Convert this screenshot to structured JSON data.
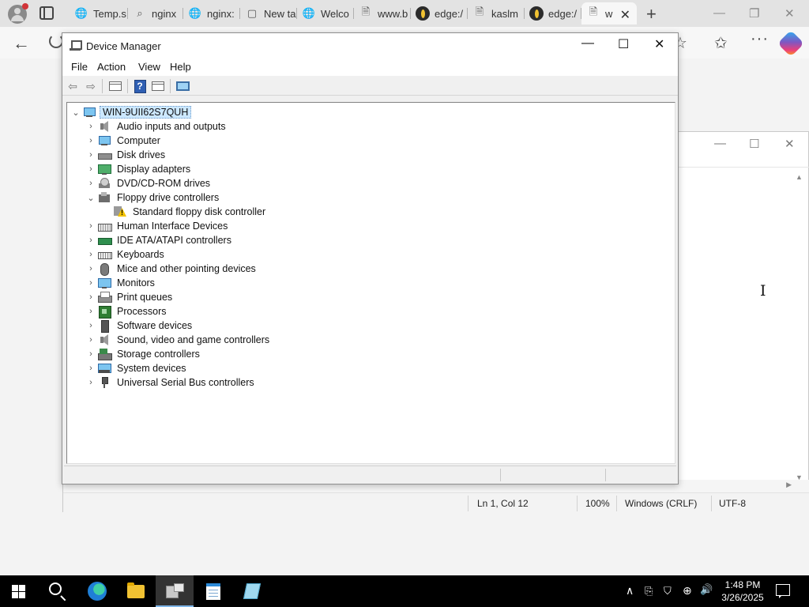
{
  "browser": {
    "tabs": [
      {
        "title": "Temp.s",
        "icon": "globe-icon"
      },
      {
        "title": "nginx",
        "icon": "search-icon"
      },
      {
        "title": "nginx:",
        "icon": "globe-icon"
      },
      {
        "title": "New ta",
        "icon": "newtab-page-icon"
      },
      {
        "title": "Welco",
        "icon": "globe-icon"
      },
      {
        "title": "www.b",
        "icon": "document-search-icon"
      },
      {
        "title": "edge:/",
        "icon": "edge-dev-icon"
      },
      {
        "title": "kaslm",
        "icon": "document-search-icon"
      },
      {
        "title": "edge:/",
        "icon": "edge-dev-icon"
      },
      {
        "title": "w",
        "icon": "document-search-icon",
        "active": true
      }
    ],
    "tab_close": "✕",
    "new_tab": "+",
    "window_controls": {
      "minimize": "—",
      "restore": "❐",
      "close": "✕"
    },
    "nav": {
      "back": "←",
      "favorite": "☆",
      "favorites": "✩",
      "more": "···"
    }
  },
  "device_manager": {
    "title": "Device Manager",
    "controls": {
      "minimize": "—",
      "maximize": "☐",
      "close": "✕"
    },
    "menu": [
      "File",
      "Action",
      "View",
      "Help"
    ],
    "toolbar": {
      "back": "⇦",
      "forward": "⇨",
      "help": "?"
    },
    "root": "WIN-9UII62S7QUH",
    "categories": [
      {
        "label": "Audio inputs and outputs",
        "icon": "speaker"
      },
      {
        "label": "Computer",
        "icon": "computer"
      },
      {
        "label": "Disk drives",
        "icon": "disk"
      },
      {
        "label": "Display adapters",
        "icon": "display"
      },
      {
        "label": "DVD/CD-ROM drives",
        "icon": "dvd"
      },
      {
        "label": "Floppy drive controllers",
        "icon": "floppy",
        "expanded": true
      },
      {
        "label": "Standard floppy disk controller",
        "icon": "warn",
        "child": true
      },
      {
        "label": "Human Interface Devices",
        "icon": "hid"
      },
      {
        "label": "IDE ATA/ATAPI controllers",
        "icon": "ide"
      },
      {
        "label": "Keyboards",
        "icon": "kbd"
      },
      {
        "label": "Mice and other pointing devices",
        "icon": "mouse"
      },
      {
        "label": "Monitors",
        "icon": "monitor"
      },
      {
        "label": "Print queues",
        "icon": "print"
      },
      {
        "label": "Processors",
        "icon": "cpu"
      },
      {
        "label": "Software devices",
        "icon": "sw"
      },
      {
        "label": "Sound, video and game controllers",
        "icon": "speaker"
      },
      {
        "label": "Storage controllers",
        "icon": "storage"
      },
      {
        "label": "System devices",
        "icon": "sys"
      },
      {
        "label": "Universal Serial Bus controllers",
        "icon": "usb"
      }
    ],
    "caret_collapsed": "›",
    "caret_expanded": "⌄"
  },
  "notepad": {
    "controls": {
      "minimize": "—",
      "maximize": "☐",
      "close": "✕"
    },
    "status": {
      "position": "Ln 1, Col 12",
      "zoom": "100%",
      "line_ending": "Windows (CRLF)",
      "encoding": "UTF-8"
    },
    "scroll": {
      "up": "▲",
      "down": "▼",
      "right": "▶"
    }
  },
  "taskbar": {
    "apps": [
      "start-button",
      "search-button",
      "edge-app",
      "file-explorer-app",
      "device-manager-app",
      "notepad-app",
      "notes-app"
    ],
    "tray": {
      "overflow": "∧",
      "network": "⊕",
      "volume": "🔊"
    },
    "clock": {
      "time": "1:48 PM",
      "date": "3/26/2025"
    }
  }
}
